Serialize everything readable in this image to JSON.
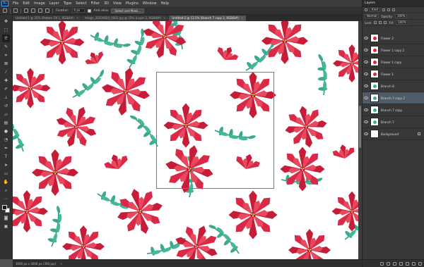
{
  "app": {
    "logo": "Ps"
  },
  "menu": [
    "File",
    "Edit",
    "Image",
    "Layer",
    "Type",
    "Select",
    "Filter",
    "3D",
    "View",
    "Plugins",
    "Window",
    "Help"
  ],
  "options_bar": {
    "feather_label": "Feather:",
    "feather_value": "0 px",
    "antialias_label": "Anti-alias",
    "select_mask_label": "Select and Mask..."
  },
  "tabs": [
    {
      "label": "Untitled-1 @ 25% (Pattern Fill 1, RGB/8#)",
      "active": false
    },
    {
      "label": "Image_20200920_0002.jpg @ 25% (Layer 2, RGB/8#)",
      "active": false
    },
    {
      "label": "Untitled-2 @ 12.5% (Branch 7 copy 2, RGB/8#)",
      "active": true
    }
  ],
  "status": {
    "text": "3000 px x 3000 px (300 ppi)",
    "arrow": ">"
  },
  "layers_panel": {
    "title": "Layers",
    "kind_label": "Kind",
    "blend_mode": "Normal",
    "opacity_label": "Opacity:",
    "opacity_value": "100%",
    "lock_label": "Lock:",
    "fill_label": "Fill:",
    "fill_value": "100%",
    "layers": [
      {
        "name": "Flower 2",
        "selected": false,
        "thumb_color": "#d42a45"
      },
      {
        "name": "Flower 1 copy 2",
        "selected": false,
        "thumb_color": "#d42a45"
      },
      {
        "name": "Flower 1 copy",
        "selected": false,
        "thumb_color": "#d42a45"
      },
      {
        "name": "Flower 1",
        "selected": false,
        "thumb_color": "#d42a45"
      },
      {
        "name": "Branch 8",
        "selected": false,
        "thumb_color": "#3cae90"
      },
      {
        "name": "Branch 7 copy 2",
        "selected": true,
        "thumb_color": "#3cae90"
      },
      {
        "name": "Branch 7 copy",
        "selected": false,
        "thumb_color": "#3cae90"
      },
      {
        "name": "Branch 7",
        "selected": false,
        "thumb_color": "#3cae90"
      },
      {
        "name": "Background",
        "selected": false,
        "thumb_color": "#ffffff"
      }
    ]
  },
  "colors": {
    "poinsettia_red": "#d1233f",
    "poinsettia_dark": "#a8152f",
    "poinsettia_light": "#e9485e",
    "leaf_teal": "#3aa98c",
    "flower_center": "#f2d25c",
    "canvas": "#ffffff",
    "ui_dark": "#323232",
    "selected_layer": "#4f5b66"
  }
}
